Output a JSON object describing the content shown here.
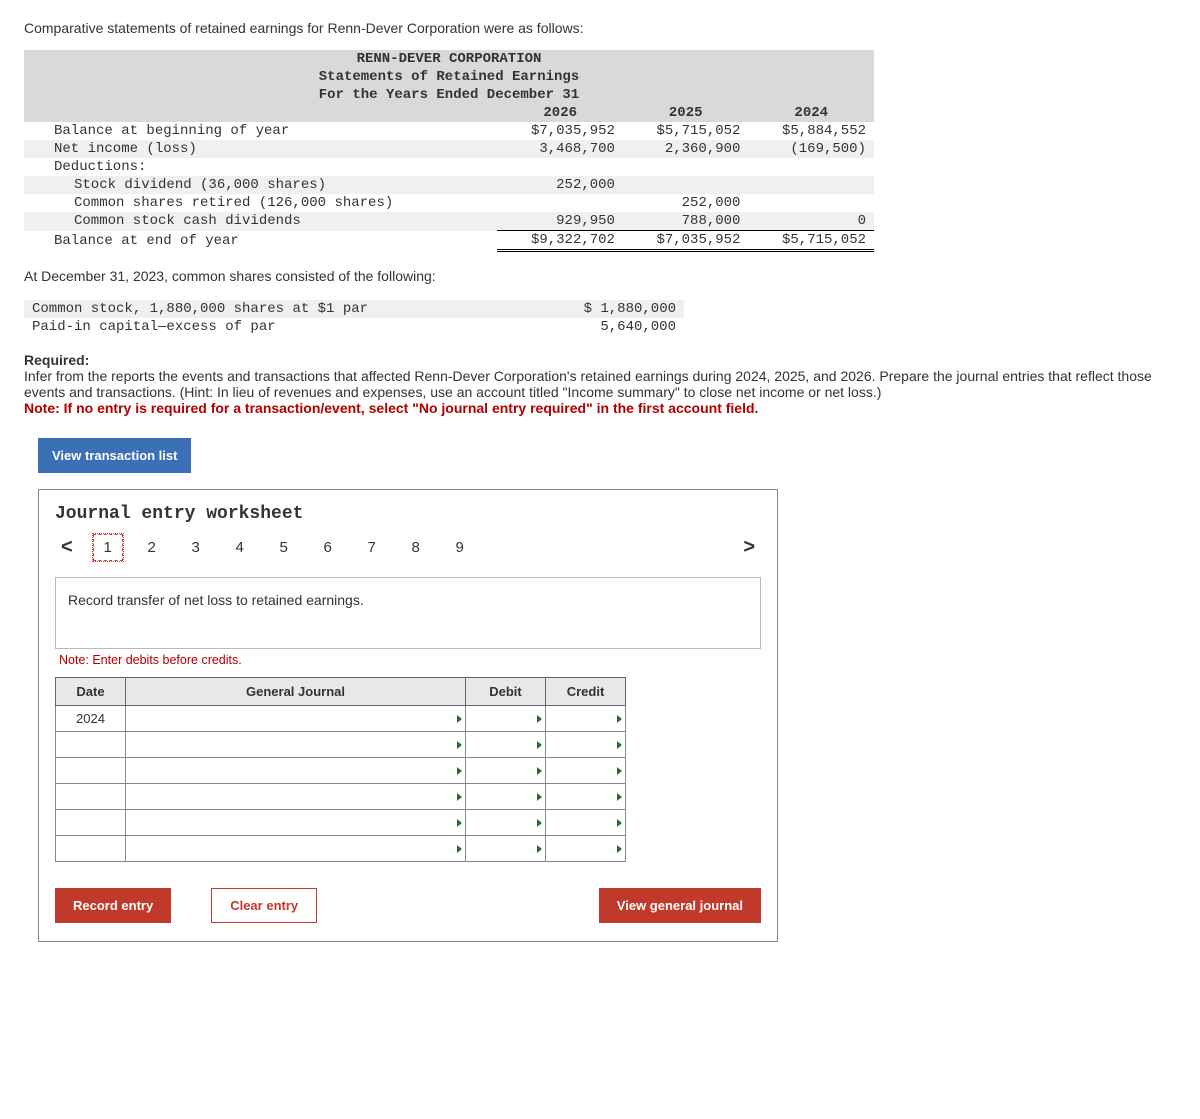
{
  "intro": "Comparative statements of retained earnings for Renn-Dever Corporation were as follows:",
  "stmt": {
    "title1": "RENN-DEVER CORPORATION",
    "title2": "Statements of Retained Earnings",
    "title3": "For the Years Ended December 31",
    "years": {
      "c1": "2026",
      "c2": "2025",
      "c3": "2024"
    },
    "rows": {
      "beg": {
        "label": "Balance at beginning of year",
        "c1": "$7,035,952",
        "c2": "$5,715,052",
        "c3": "$5,884,552"
      },
      "ni": {
        "label": "Net income (loss)",
        "c1": "3,468,700",
        "c2": "2,360,900",
        "c3": "(169,500)"
      },
      "ded": {
        "label": "Deductions:"
      },
      "sd": {
        "label": "Stock dividend (36,000 shares)",
        "c1": "252,000",
        "c2": "",
        "c3": ""
      },
      "ret": {
        "label": "Common shares retired (126,000 shares)",
        "c1": "",
        "c2": "252,000",
        "c3": ""
      },
      "cash": {
        "label": "Common stock cash dividends",
        "c1": "929,950",
        "c2": "788,000",
        "c3": "0"
      },
      "end": {
        "label": "Balance at end of year",
        "c1": "$9,322,702",
        "c2": "$7,035,952",
        "c3": "$5,715,052"
      }
    }
  },
  "para2": "At December 31, 2023, common shares consisted of the following:",
  "shares": {
    "r1": {
      "label": "Common stock, 1,880,000 shares at $1 par",
      "val": "$ 1,880,000"
    },
    "r2": {
      "label": "Paid-in capital—excess of par",
      "val": "5,640,000"
    }
  },
  "required": {
    "head": "Required:",
    "body": "Infer from the reports the events and transactions that affected Renn-Dever Corporation's retained earnings during 2024, 2025, and 2026. Prepare the journal entries that reflect those events and transactions. (Hint: In lieu of revenues and expenses, use an account titled \"Income summary\" to close net income or net loss.)",
    "note": "Note: If no entry is required for a transaction/event, select \"No journal entry required\" in the first account field."
  },
  "buttons": {
    "view_list": "View transaction list",
    "record": "Record entry",
    "clear": "Clear entry",
    "view_gj": "View general journal"
  },
  "worksheet": {
    "title": "Journal entry worksheet",
    "tabs": [
      "1",
      "2",
      "3",
      "4",
      "5",
      "6",
      "7",
      "8",
      "9"
    ],
    "instruction": "Record transfer of net loss to retained earnings.",
    "note": "Note: Enter debits before credits.",
    "headers": {
      "date": "Date",
      "gj": "General Journal",
      "debit": "Debit",
      "credit": "Credit"
    },
    "date_val": "2024"
  },
  "chart_data": {
    "type": "table",
    "title": "Statements of Retained Earnings — For the Years Ended December 31",
    "columns": [
      "Line item",
      "2026",
      "2025",
      "2024"
    ],
    "rows": [
      [
        "Balance at beginning of year",
        7035952,
        5715052,
        5884552
      ],
      [
        "Net income (loss)",
        3468700,
        2360900,
        -169500
      ],
      [
        "Stock dividend (36,000 shares)",
        252000,
        null,
        null
      ],
      [
        "Common shares retired (126,000 shares)",
        null,
        252000,
        null
      ],
      [
        "Common stock cash dividends",
        929950,
        788000,
        0
      ],
      [
        "Balance at end of year",
        9322702,
        7035952,
        5715052
      ]
    ],
    "supplementary": {
      "date": "December 31, 2023",
      "common_stock_shares": 1880000,
      "par_value": 1,
      "common_stock_amount": 1880000,
      "paid_in_capital_excess_of_par": 5640000
    }
  }
}
